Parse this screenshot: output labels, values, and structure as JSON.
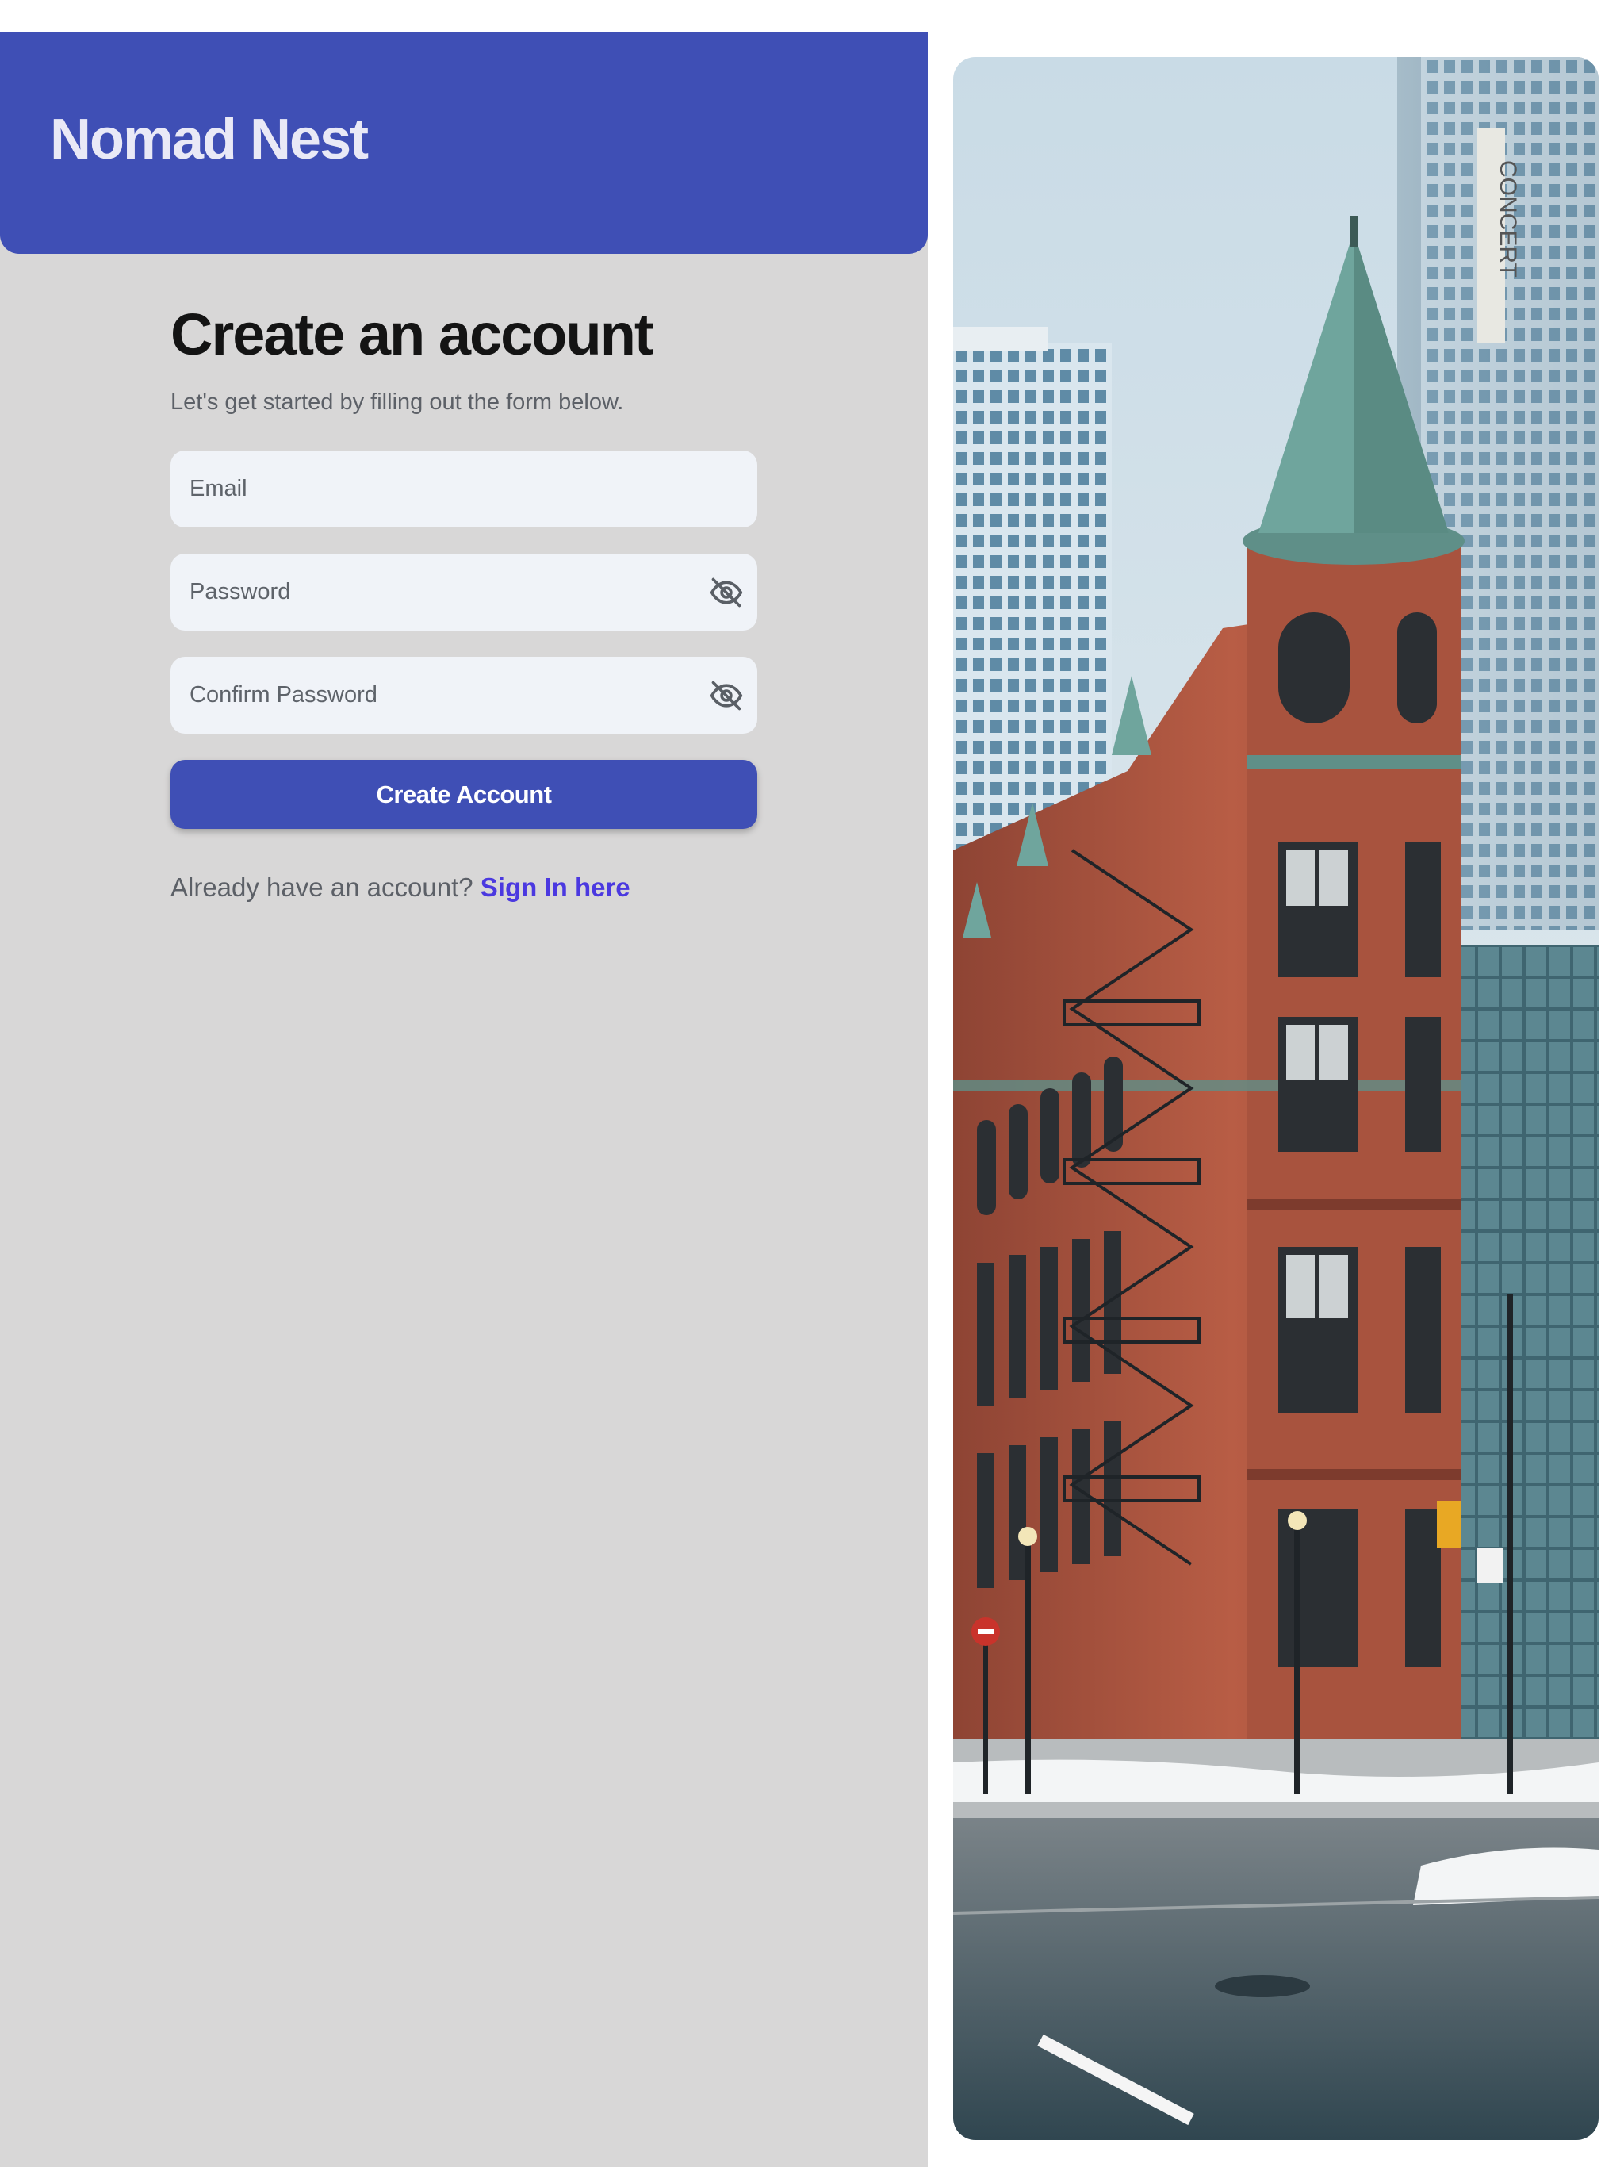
{
  "brand": {
    "name": "Nomad Nest"
  },
  "form": {
    "title": "Create an account",
    "subtitle": "Let's get started by filling out the form below.",
    "email_placeholder": "Email",
    "password_placeholder": "Password",
    "confirm_password_placeholder": "Confirm Password",
    "submit_label": "Create Account",
    "visibility_icon": "eye-off-icon"
  },
  "signin": {
    "prompt": "Already have an account?",
    "link_label": "Sign In here"
  },
  "hero": {
    "sign_text": "CONCERT"
  },
  "colors": {
    "brand": "#3f4fb5",
    "page_background": "#d8d7d7",
    "field_background": "#f0f3f8",
    "link": "#4b39e0"
  }
}
